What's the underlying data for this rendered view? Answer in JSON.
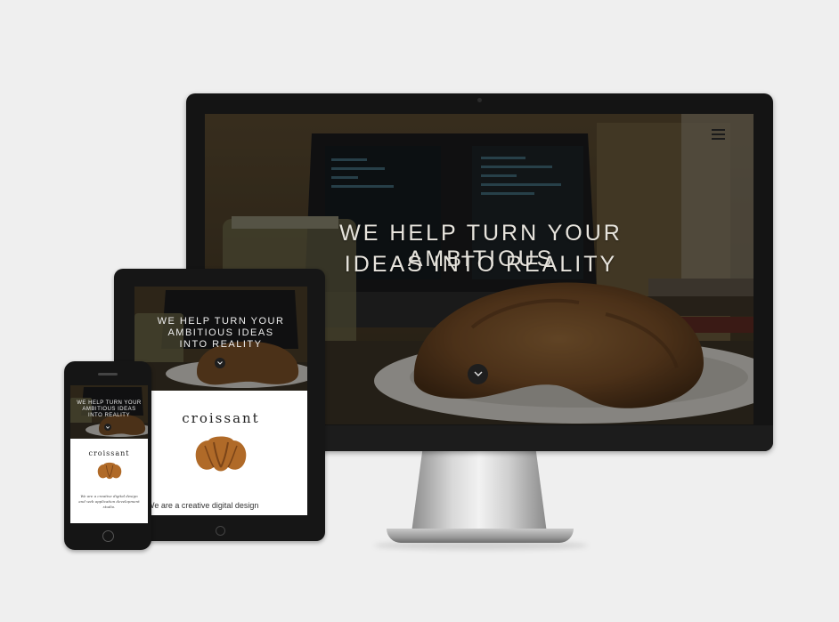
{
  "hero": {
    "line1": "WE HELP TURN YOUR AMBITIOUS",
    "line2": "IDEAS INTO REALITY",
    "tablet_line1": "WE HELP TURN YOUR",
    "tablet_line2": "AMBITIOUS IDEAS",
    "tablet_line3": "INTO REALITY",
    "phone_line1": "WE HELP TURN YOUR",
    "phone_line2": "AMBITIOUS IDEAS",
    "phone_line3": "INTO REALITY",
    "scroll_icon": "chevron-down-icon"
  },
  "nav": {
    "menu_icon": "hamburger-menu-icon"
  },
  "brand": {
    "name": "croissant",
    "logo_icon": "croissant-icon"
  },
  "about": {
    "intro": "We are a creative digital design",
    "phone_intro": "We are a creative digital design and web application development studio."
  },
  "colors": {
    "overlay": "#000000",
    "text": "#e7e4dd",
    "frame": "#141414",
    "background": "#efefef"
  }
}
